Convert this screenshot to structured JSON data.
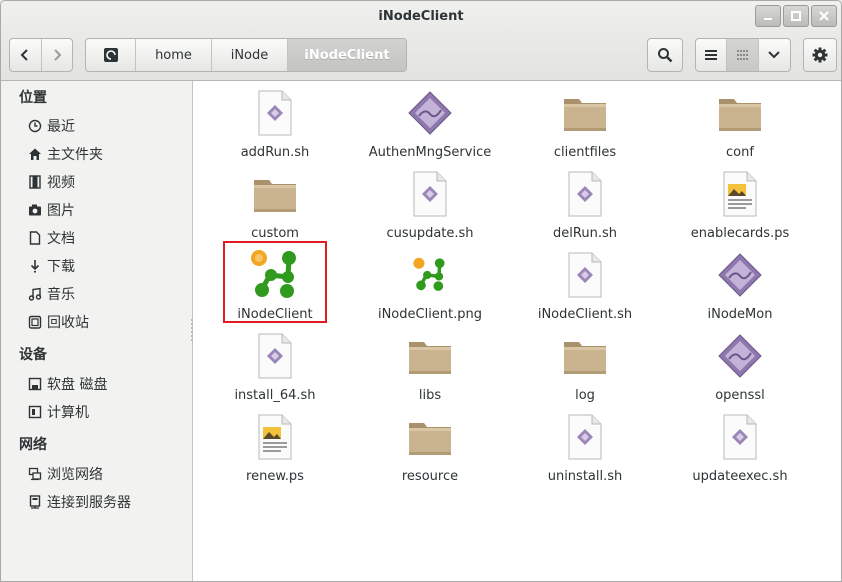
{
  "window": {
    "title": "iNodeClient"
  },
  "toolbar": {
    "breadcrumbs": [
      "home",
      "iNode",
      "iNodeClient"
    ]
  },
  "sidebar": {
    "sections": [
      {
        "header": "位置",
        "items": [
          {
            "label": "最近",
            "icon": "clock-icon"
          },
          {
            "label": "主文件夹",
            "icon": "home-icon"
          },
          {
            "label": "视频",
            "icon": "film-icon"
          },
          {
            "label": "图片",
            "icon": "camera-icon"
          },
          {
            "label": "文档",
            "icon": "document-icon"
          },
          {
            "label": "下载",
            "icon": "download-icon"
          },
          {
            "label": "音乐",
            "icon": "music-icon"
          },
          {
            "label": "回收站",
            "icon": "trash-icon"
          }
        ]
      },
      {
        "header": "设备",
        "items": [
          {
            "label": "软盘 磁盘",
            "icon": "floppy-icon"
          },
          {
            "label": "计算机",
            "icon": "computer-icon"
          }
        ]
      },
      {
        "header": "网络",
        "items": [
          {
            "label": "浏览网络",
            "icon": "network-icon"
          },
          {
            "label": "连接到服务器",
            "icon": "server-icon"
          }
        ]
      }
    ]
  },
  "files": [
    {
      "name": "addRun.sh",
      "type": "script"
    },
    {
      "name": "AuthenMngService",
      "type": "executable"
    },
    {
      "name": "clientfiles",
      "type": "folder"
    },
    {
      "name": "conf",
      "type": "folder"
    },
    {
      "name": "custom",
      "type": "folder"
    },
    {
      "name": "cusupdate.sh",
      "type": "script"
    },
    {
      "name": "delRun.sh",
      "type": "script"
    },
    {
      "name": "enablecards.ps",
      "type": "postscript"
    },
    {
      "name": "iNodeClient",
      "type": "inode-app"
    },
    {
      "name": "iNodeClient.png",
      "type": "inode-image"
    },
    {
      "name": "iNodeClient.sh",
      "type": "script"
    },
    {
      "name": "iNodeMon",
      "type": "executable"
    },
    {
      "name": "install_64.sh",
      "type": "script"
    },
    {
      "name": "libs",
      "type": "folder"
    },
    {
      "name": "log",
      "type": "folder"
    },
    {
      "name": "openssl",
      "type": "executable"
    },
    {
      "name": "renew.ps",
      "type": "postscript"
    },
    {
      "name": "resource",
      "type": "folder"
    },
    {
      "name": "uninstall.sh",
      "type": "script"
    },
    {
      "name": "updateexec.sh",
      "type": "script"
    }
  ],
  "highlighted_file": "iNodeClient",
  "colors": {
    "highlight_border": "#e11b22",
    "folder": "#c9b48f",
    "inode_green": "#2f9a1e",
    "inode_orange": "#f2a623"
  }
}
